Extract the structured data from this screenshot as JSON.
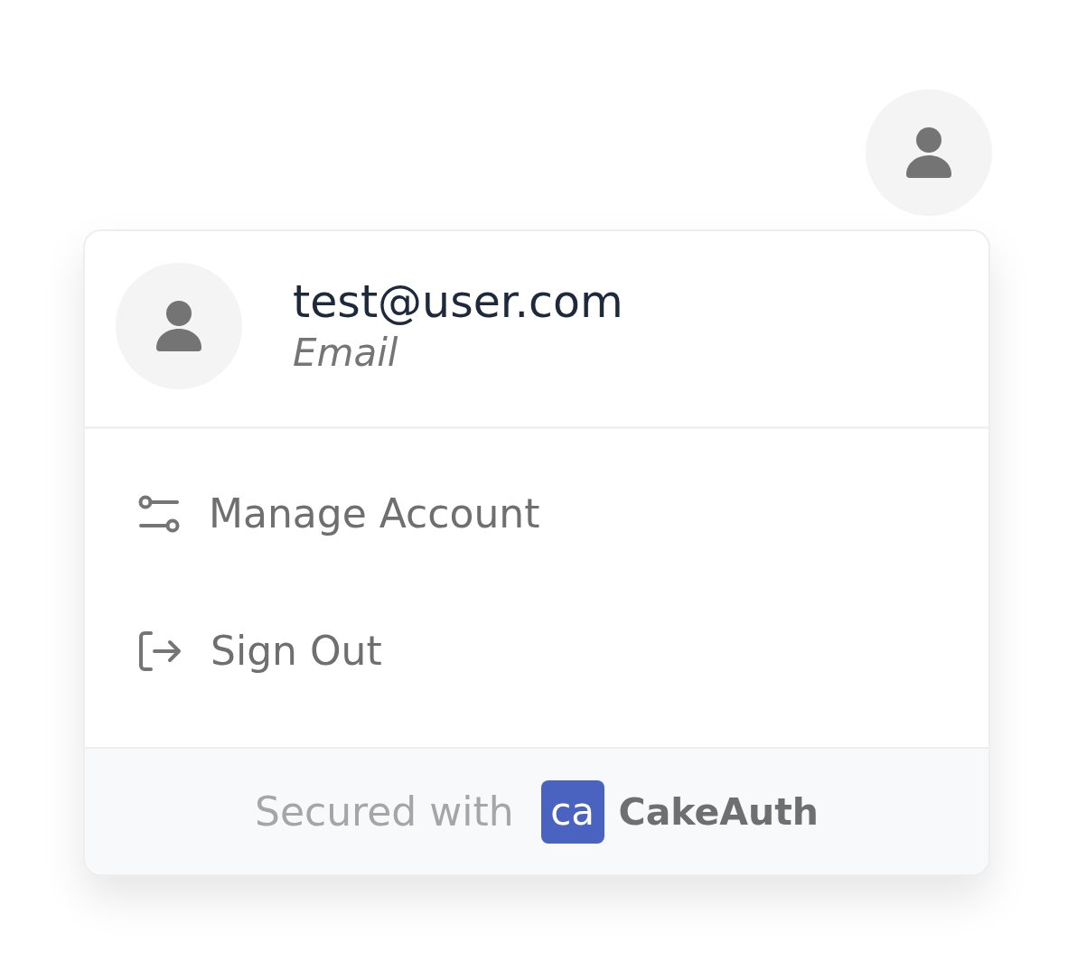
{
  "account_menu": {
    "user": {
      "email": "test@user.com",
      "label": "Email"
    },
    "items": [
      {
        "kind": "manage",
        "label": "Manage Account"
      },
      {
        "kind": "sign_out",
        "label": "Sign Out"
      }
    ],
    "footer": {
      "text": "Secured with",
      "logo_mark": "ca",
      "brand": "CakeAuth"
    }
  }
}
